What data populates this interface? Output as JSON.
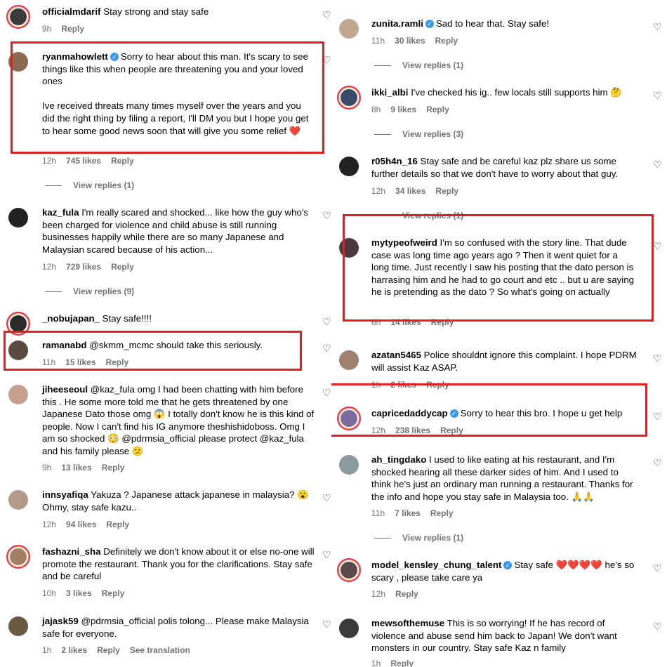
{
  "left": [
    {
      "user": "officialmdarif",
      "verified": false,
      "text": "Stay strong and stay safe",
      "time": "9h",
      "likes": "",
      "reply": "Reply",
      "replies": "",
      "color": "#3a3a3a"
    },
    {
      "user": "ryanmahowlett",
      "verified": true,
      "text": "Sorry to hear about this man. It's scary to see things like this when people are threatening you and your loved ones\n\nIve received threats many times myself over the years and you did the right thing by filing a report, I'll DM you but I hope you get to hear some good news soon that will give you some relief ❤️",
      "time": "12h",
      "likes": "745 likes",
      "reply": "Reply",
      "replies": "View replies (1)",
      "color": "#8a6a50"
    },
    {
      "user": "kaz_fula",
      "verified": false,
      "text": "I'm really scared and shocked... like how the guy who's been charged for violence and child abuse is still running businesses happily while there are so many Japanese and Malaysian scared because of his action...",
      "time": "12h",
      "likes": "729 likes",
      "reply": "Reply",
      "replies": "View replies (9)",
      "color": "#222"
    },
    {
      "user": "_nobujapan_",
      "verified": false,
      "text": "Stay safe!!!!",
      "time": "",
      "likes": "",
      "reply": "",
      "replies": "",
      "color": "#2b2b2b"
    },
    {
      "user": "ramanabd",
      "verified": false,
      "text": "@skmm_mcmc should take this seriously.",
      "time": "11h",
      "likes": "15 likes",
      "reply": "Reply",
      "replies": "",
      "color": "#5a4a40"
    },
    {
      "user": "jiheeseoul",
      "verified": false,
      "text": "@kaz_fula omg I had been chatting with him before this . He some more told me that he gets threatened by one Japanese Dato those omg 😱 I totally don't know he is this kind of people. Now I can't find his IG anymore theshishidoboss. Omg I am so shocked 😳 @pdrmsia_official please protect @kaz_fula and his family please 🙁",
      "time": "9h",
      "likes": "13 likes",
      "reply": "Reply",
      "replies": "",
      "color": "#c8a090"
    },
    {
      "user": "innsyafiqa",
      "verified": false,
      "text": "Yakuza ? Japanese attack japanese in malaysia? 😮 Ohmy, stay safe kazu..",
      "time": "12h",
      "likes": "94 likes",
      "reply": "Reply",
      "replies": "",
      "color": "#b49a8a"
    },
    {
      "user": "fashazni_sha",
      "verified": false,
      "text": "Definitely we don't know about it or else no-one will promote the restaurant. Thank you for the clarifications. Stay safe and be careful",
      "time": "10h",
      "likes": "3 likes",
      "reply": "Reply",
      "replies": "",
      "color": "#a08060"
    },
    {
      "user": "jajask59",
      "verified": false,
      "text": "@pdrmsia_official polis tolong... Please make Malaysia safe for everyone.",
      "time": "1h",
      "likes": "2 likes",
      "reply": "Reply",
      "replies": "See translation",
      "color": "#6a5a40"
    }
  ],
  "right": [
    {
      "user": "zunita.ramli",
      "verified": true,
      "text": "Sad to hear that. Stay safe!",
      "time": "11h",
      "likes": "30 likes",
      "reply": "Reply",
      "replies": "View replies (1)",
      "color": "#c0a890"
    },
    {
      "user": "ikki_albi",
      "verified": false,
      "text": "I've checked his ig.. few locals still supports him 🤔",
      "time": "8h",
      "likes": "9 likes",
      "reply": "Reply",
      "replies": "View replies (3)",
      "color": "#3a4a6a"
    },
    {
      "user": "r05h4n_16",
      "verified": false,
      "text": "Stay safe and be careful kaz plz share us some further details so that we don't have to worry about that guy.",
      "time": "12h",
      "likes": "34 likes",
      "reply": "Reply",
      "replies": "View replies (1)",
      "color": "#222"
    },
    {
      "user": "mytypeofweird",
      "verified": false,
      "text": "I'm so confused with the story line. That dude case was long time ago years ago ? Then it went quiet for a long time. Just recently I saw his posting that the dato person is harrasing him and he had to go court and etc .. but u are saying he is pretending as the dato ? So what's going on actually",
      "time": "6h",
      "likes": "14 likes",
      "reply": "Reply",
      "replies": "",
      "color": "#4a3a40"
    },
    {
      "user": "azatan5465",
      "verified": false,
      "text": "Police shouldnt ignore this complaint. I hope PDRM will assist Kaz ASAP.",
      "time": "1h",
      "likes": "2 likes",
      "reply": "Reply",
      "replies": "",
      "color": "#a08070"
    },
    {
      "user": "capricedaddycap",
      "verified": true,
      "text": "Sorry to hear this bro. I hope u get help",
      "time": "12h",
      "likes": "238 likes",
      "reply": "Reply",
      "replies": "",
      "color": "#7a6aa0"
    },
    {
      "user": "ah_tingdako",
      "verified": false,
      "text": "I used to like eating at his restaurant, and I'm shocked hearing all these darker sides of him. And I used to think he's just an ordinary man running a restaurant. Thanks for the info and hope you stay safe in Malaysia too. 🙏🙏",
      "time": "11h",
      "likes": "7 likes",
      "reply": "Reply",
      "replies": "View replies (1)",
      "color": "#8a9aa0"
    },
    {
      "user": "model_kensley_chung_talent",
      "verified": true,
      "text": "Stay safe ❤️❤️❤️❤️ he's so scary , please take care ya",
      "time": "12h",
      "likes": "",
      "reply": "Reply",
      "replies": "",
      "color": "#5a4a4a"
    },
    {
      "user": "mewsofthemuse",
      "verified": false,
      "text": "This is so worrying! If he has record of violence and abuse send him back to Japan! We don't want monsters in our country. Stay safe Kaz n family",
      "time": "1h",
      "likes": "",
      "reply": "Reply",
      "replies": "",
      "color": "#3a3a3a"
    }
  ],
  "highlight_color": "#e02020"
}
